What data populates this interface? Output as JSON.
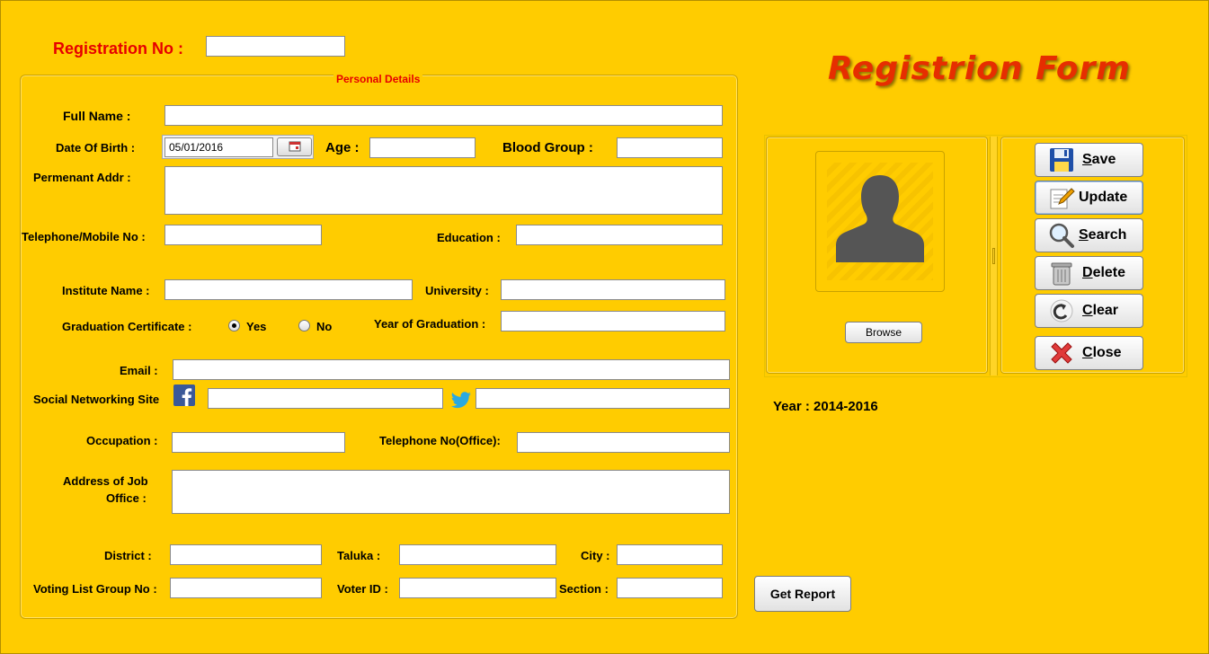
{
  "form": {
    "title": "Registrion Form",
    "registration_label": "Registration No :",
    "registration_value": "",
    "personal_details_title": "Personal Details",
    "year_label": "Year : 2014-2016"
  },
  "fields": {
    "full_name": {
      "label": "Full Name :",
      "value": ""
    },
    "dob": {
      "label": "Date Of Birth :",
      "value": "05/01/2016"
    },
    "age": {
      "label": "Age :",
      "value": ""
    },
    "blood_group": {
      "label": "Blood Group :",
      "value": ""
    },
    "perm_addr": {
      "label": "Permenant Addr  :",
      "value": ""
    },
    "telephone": {
      "label": "Telephone/Mobile No :",
      "value": ""
    },
    "education": {
      "label": "Education :",
      "value": ""
    },
    "institute": {
      "label": "Institute Name :",
      "value": ""
    },
    "university": {
      "label": "University :",
      "value": ""
    },
    "grad_cert": {
      "label": "Graduation Certificate :",
      "yes": "Yes",
      "no": "No",
      "selected": "Yes"
    },
    "year_grad": {
      "label": "Year of Graduation :",
      "value": ""
    },
    "email": {
      "label": "Email :",
      "value": ""
    },
    "social": {
      "label": "Social Networking Site",
      "facebook": "",
      "twitter": ""
    },
    "occupation": {
      "label": "Occupation :",
      "value": ""
    },
    "tel_office": {
      "label": "Telephone No(Office):",
      "value": ""
    },
    "job_addr": {
      "label_line1": "Address of Job",
      "label_line2": "Office :",
      "value": ""
    },
    "district": {
      "label": "District  :",
      "value": ""
    },
    "taluka": {
      "label": "Taluka :",
      "value": ""
    },
    "city": {
      "label": "City :",
      "value": ""
    },
    "voting_group": {
      "label": "Voting List Group No :",
      "value": ""
    },
    "voter_id": {
      "label": "Voter ID :",
      "value": ""
    },
    "section": {
      "label": "Section :",
      "value": ""
    }
  },
  "buttons": {
    "save": {
      "pre": "",
      "ul": "S",
      "post": "ave"
    },
    "update": {
      "pre": "Update",
      "ul": "",
      "post": ""
    },
    "search": {
      "pre": "",
      "ul": "S",
      "post": "earch"
    },
    "delete": {
      "pre": "",
      "ul": "D",
      "post": "elete"
    },
    "clear": {
      "pre": "",
      "ul": "C",
      "post": "lear"
    },
    "close": {
      "pre": "",
      "ul": "C",
      "post": "lose"
    },
    "browse": "Browse",
    "get_report": "Get Report"
  },
  "icons": {
    "save": "floppy-disk-icon",
    "update": "edit-pencil-icon",
    "search": "magnifier-icon",
    "delete": "trash-can-icon",
    "clear": "undo-arrow-icon",
    "close": "red-x-icon",
    "calendar": "calendar-icon",
    "photo": "user-silhouette-icon",
    "facebook": "facebook-icon",
    "twitter": "twitter-bird-icon"
  },
  "colors": {
    "background": "#ffcc00",
    "label_red": "#e60000",
    "title_red": "#e62e00"
  }
}
